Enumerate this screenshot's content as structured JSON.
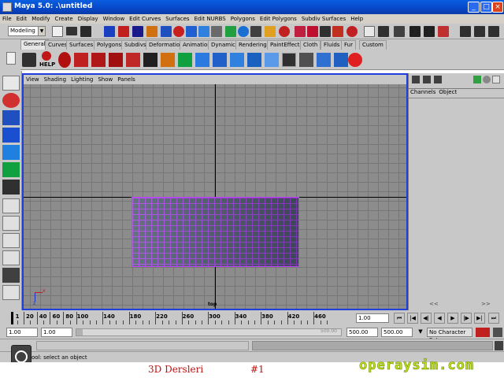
{
  "window": {
    "title": "Maya 5.0: .\\untitled",
    "min": "_",
    "max": "□",
    "close": "×"
  },
  "menubar": [
    "File",
    "Edit",
    "Modify",
    "Create",
    "Display",
    "Window",
    "Edit Curves",
    "Surfaces",
    "Edit NURBS",
    "Polygons",
    "Edit Polygons",
    "Subdiv Surfaces",
    "Help"
  ],
  "status_line": {
    "menu_set": "Modeling"
  },
  "shelf": {
    "tabs": [
      "General",
      "Curves",
      "Surfaces",
      "Polygons",
      "Subdivs",
      "Deformation",
      "Animation",
      "Dynamics",
      "Rendering",
      "PaintEffects",
      "Cloth",
      "Fluids",
      "Fur",
      "Custom"
    ],
    "active_tab": "General",
    "help_label": "HELP"
  },
  "viewport": {
    "menu": [
      "View",
      "Shading",
      "Lighting",
      "Show",
      "Panels"
    ],
    "camera_label": "top",
    "axis_x": "x",
    "axis_z": "z",
    "colors": {
      "border": "#1f3fdc",
      "background": "#8c8c8c",
      "wire": "#c040ff"
    }
  },
  "channel_box": {
    "menu": [
      "Channels",
      "Object"
    ],
    "scroll_left": "<<",
    "scroll_right": ">>"
  },
  "time_slider": {
    "ticks": [
      "1",
      "20",
      "40",
      "60",
      "80",
      "100",
      "140",
      "180",
      "220",
      "260",
      "300",
      "340",
      "380",
      "420",
      "460"
    ],
    "current_frame": "1.00"
  },
  "range_slider": {
    "start_time": "1.00",
    "playback_start": "1.00",
    "playback_end": "500.00",
    "end_time": "500.00",
    "range_end_display": "500.00",
    "character_set": "No Character Set"
  },
  "help_line": {
    "text": "ool: select an object"
  },
  "overlay": {
    "title": "3D Dersleri",
    "number": "#1",
    "site": "operaysim.com"
  }
}
